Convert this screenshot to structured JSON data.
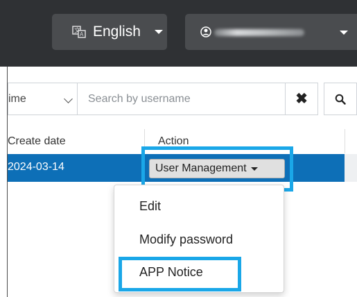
{
  "header": {
    "language_label": "English",
    "language_icon": "translate-icon",
    "user_icon": "user-circle-icon"
  },
  "search": {
    "field_select_value": "ime",
    "placeholder": "Search by username",
    "clear_icon": "close-icon",
    "search_icon": "search-icon"
  },
  "table": {
    "headers": [
      "Create date",
      "Action"
    ],
    "rows": [
      {
        "create_date": "2024-03-14",
        "action_label": "User Management"
      }
    ]
  },
  "dropdown": {
    "items": [
      "Edit",
      "Modify password",
      "APP Notice"
    ]
  },
  "colors": {
    "topbar": "#2f3134",
    "selected_row": "#0d6fb7",
    "highlight": "#1aa7e8"
  }
}
